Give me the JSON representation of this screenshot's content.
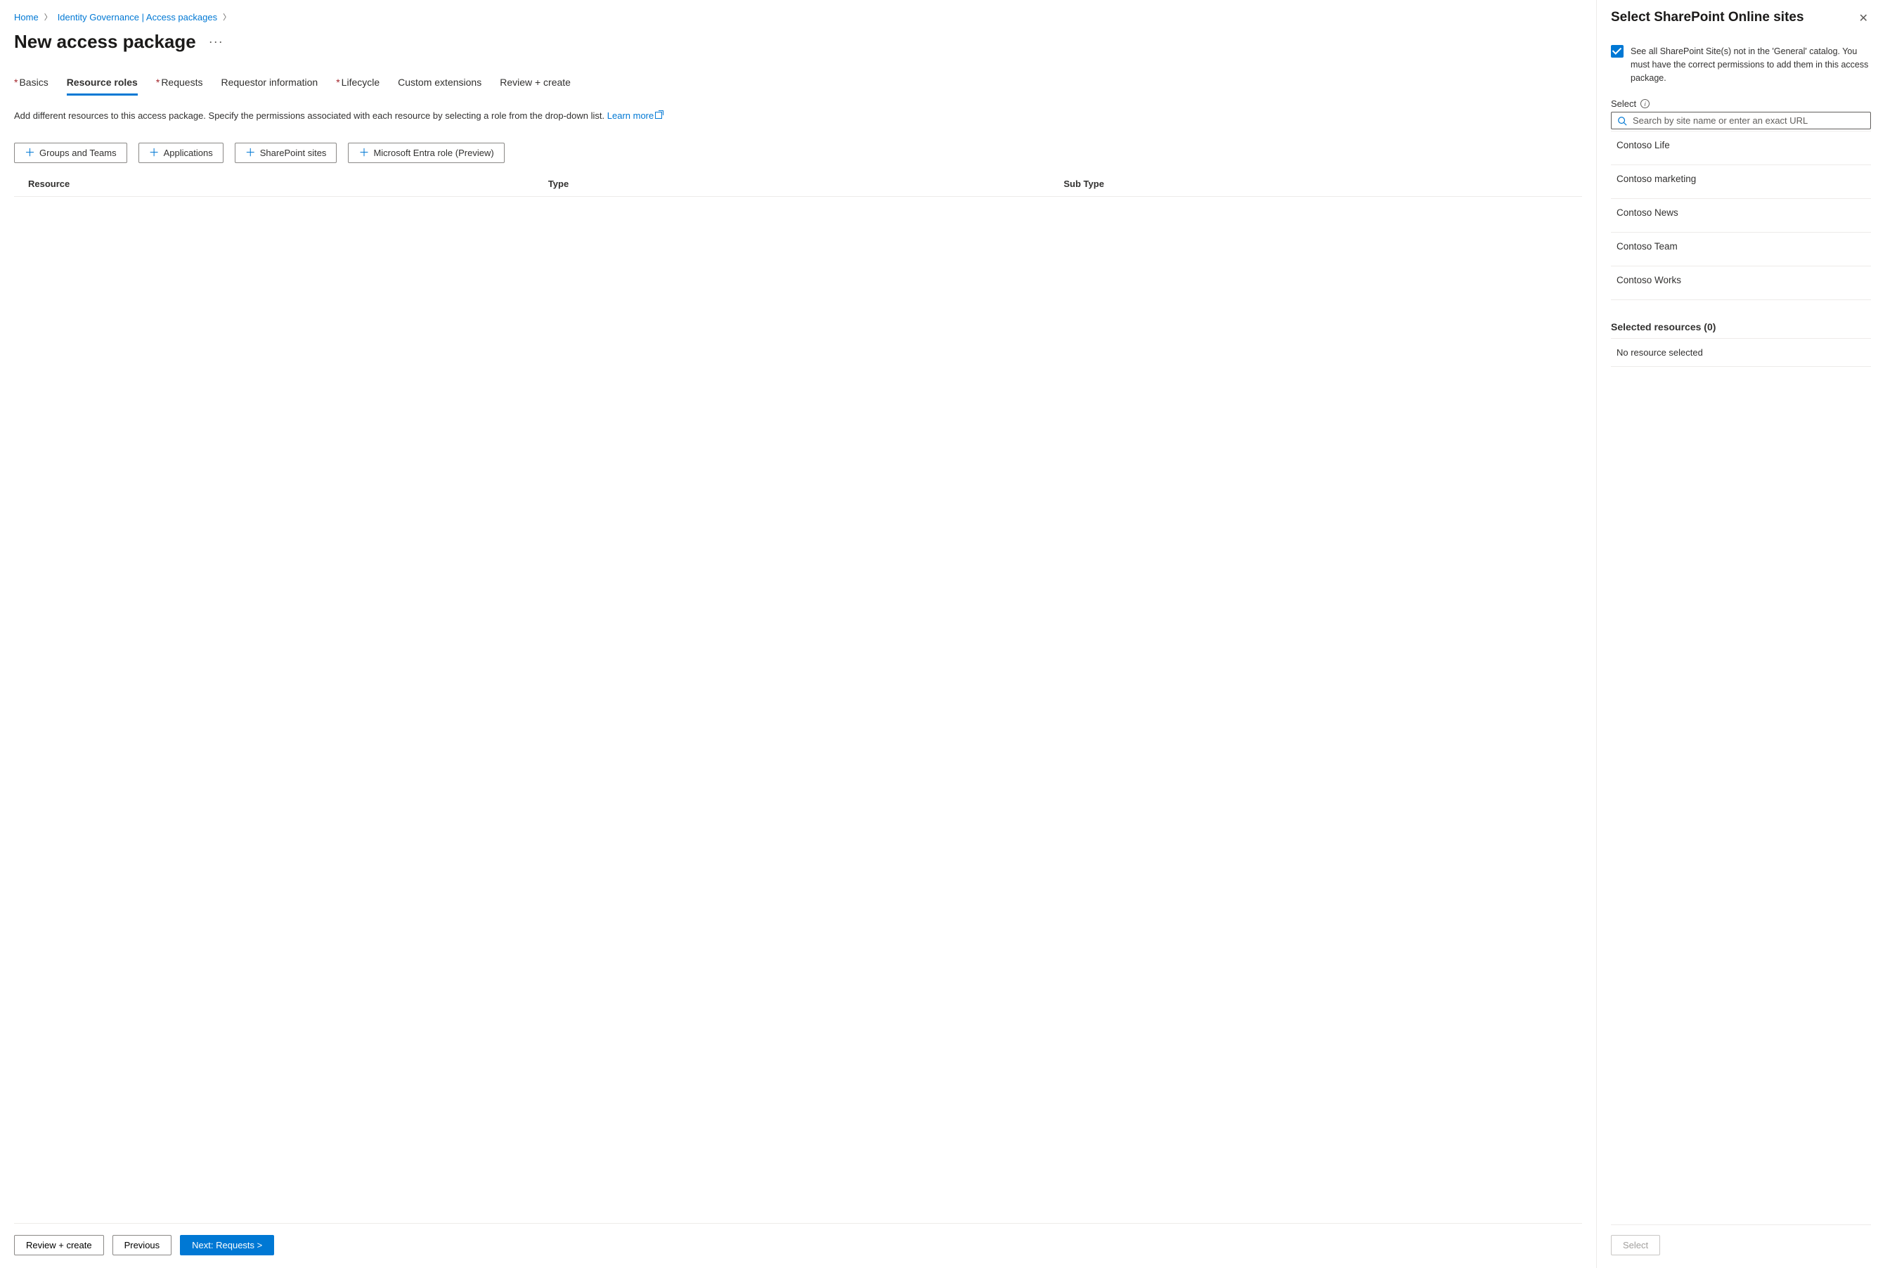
{
  "breadcrumb": {
    "home": "Home",
    "gov": "Identity Governance | Access packages"
  },
  "page_title": "New access package",
  "tabs": {
    "basics": "Basics",
    "resource_roles": "Resource roles",
    "requests": "Requests",
    "requestor_info": "Requestor information",
    "lifecycle": "Lifecycle",
    "custom_ext": "Custom extensions",
    "review_create": "Review + create"
  },
  "description": {
    "text": "Add different resources to this access package. Specify the permissions associated with each resource by selecting a role from the drop-down list. ",
    "learn_more": "Learn more"
  },
  "resource_buttons": {
    "groups": "Groups and Teams",
    "apps": "Applications",
    "sp": "SharePoint sites",
    "entra": "Microsoft Entra role (Preview)"
  },
  "table": {
    "resource": "Resource",
    "type": "Type",
    "subtype": "Sub Type"
  },
  "footer": {
    "review": "Review + create",
    "previous": "Previous",
    "next": "Next: Requests >"
  },
  "panel": {
    "title": "Select SharePoint Online sites",
    "checkbox_text": "See all SharePoint Site(s) not in the 'General' catalog. You must have the correct permissions to add them in this access package.",
    "select_label": "Select",
    "search_placeholder": "Search by site name or enter an exact URL",
    "sites": [
      "Contoso Life",
      "Contoso marketing",
      "Contoso News",
      "Contoso Team",
      "Contoso Works"
    ],
    "selected_header": "Selected resources (0)",
    "no_selected": "No resource selected",
    "select_btn": "Select"
  }
}
